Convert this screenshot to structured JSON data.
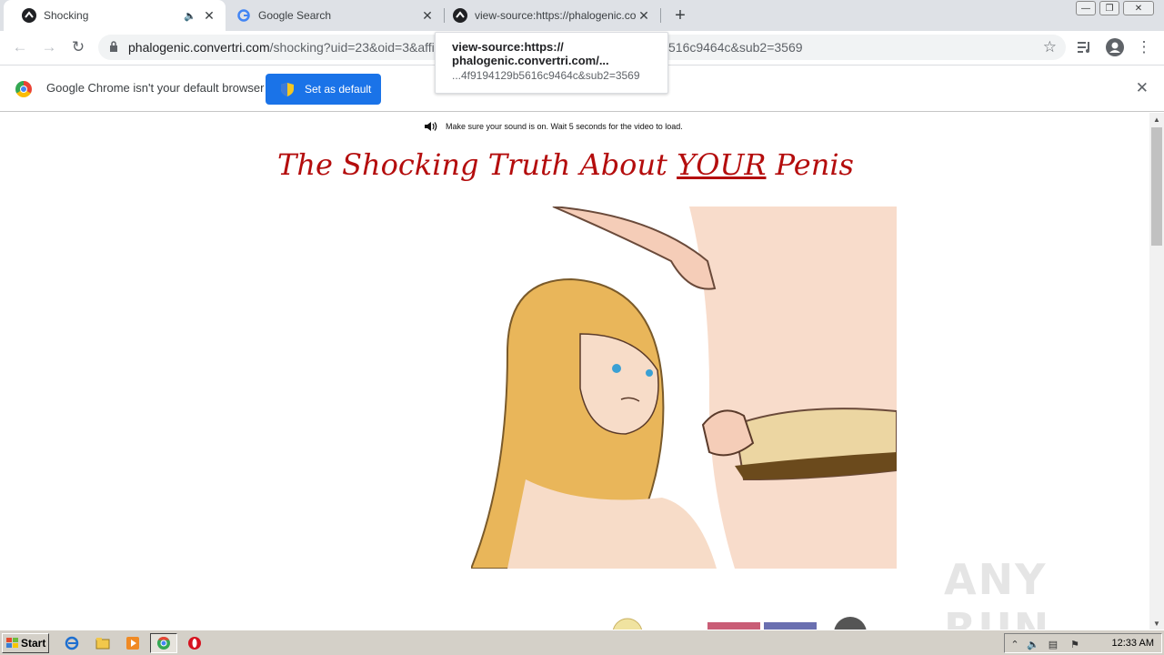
{
  "tabs": [
    {
      "title": "Shocking",
      "active": true,
      "audio": true
    },
    {
      "title": "Google Search",
      "active": false
    },
    {
      "title": "view-source:https://phalogenic.conv",
      "active": false
    }
  ],
  "toolbar": {
    "url_host": "phalogenic.convertri.com",
    "url_path_visible": "/shocking?uid=23&oid=3&affi",
    "url_tail_visible": "516c9464c&sub2=3569"
  },
  "tooltip": {
    "line1": "view-source:https://",
    "line2": "phalogenic.convertri.com/...",
    "line3": "...4f9194129b5616c9464c&sub2=3569"
  },
  "infobar": {
    "message": "Google Chrome isn't your default browser",
    "button_label": "Set as default"
  },
  "page": {
    "sound_notice": "Make sure your sound is on. Wait 5 seconds for the video to load.",
    "headline_pre": "The Shocking Truth About ",
    "headline_emph": "YOUR",
    "headline_post": " Penis"
  },
  "watermark": "ANY RUN",
  "taskbar": {
    "start_label": "Start",
    "clock": "12:33 AM"
  },
  "colors": {
    "headline": "#b40d0d",
    "button": "#1a73e8",
    "tabstrip": "#dee1e6"
  }
}
